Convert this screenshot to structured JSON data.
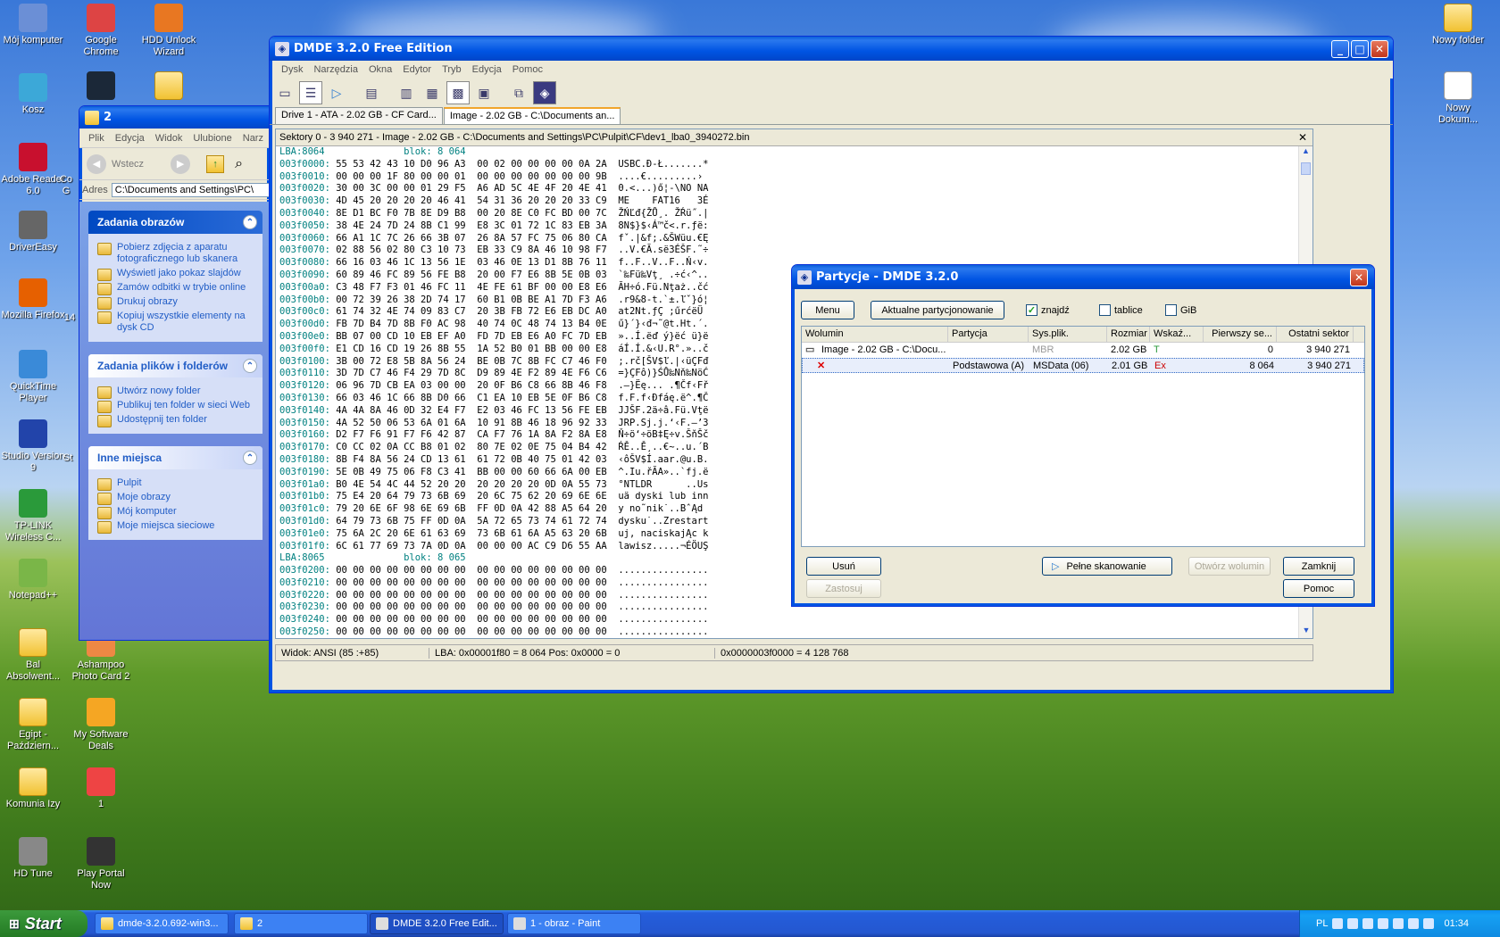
{
  "desktop_icons_left": [
    {
      "label": "Mój komputer",
      "icon": "computer-icon"
    },
    {
      "label": "Google Chrome",
      "icon": "chrome-icon"
    },
    {
      "label": "HDD Unlock Wizard",
      "icon": "hdd-unlock-icon"
    },
    {
      "label": "Kosz",
      "icon": "recycle-bin-icon"
    },
    {
      "label": "",
      "icon": "steam-icon"
    },
    {
      "label": "",
      "icon": "folder-icon"
    },
    {
      "label": "Adobe Reader 6.0",
      "icon": "adobe-reader-icon"
    },
    {
      "label": "DriverEasy",
      "icon": "drivereasy-icon"
    },
    {
      "label": "Mozilla Firefox",
      "icon": "firefox-icon"
    },
    {
      "label": "QuickTime Player",
      "icon": "quicktime-icon"
    },
    {
      "label": "Studio Version 9",
      "icon": "studio-icon"
    },
    {
      "label": "TP-LINK Wireless C...",
      "icon": "tplink-icon"
    },
    {
      "label": "Notepad++",
      "icon": "notepadpp-icon"
    },
    {
      "label": "Bal Absolwent...",
      "icon": "folder-icon"
    },
    {
      "label": "Ashampoo Photo Card 2",
      "icon": "ashampoo-icon"
    },
    {
      "label": "Egipt - Październ...",
      "icon": "folder-icon"
    },
    {
      "label": "My Software Deals",
      "icon": "cart-icon"
    },
    {
      "label": "Komunia Izy",
      "icon": "folder-icon"
    },
    {
      "label": "1",
      "icon": "image-file-icon"
    },
    {
      "label": "HD Tune",
      "icon": "hdtune-icon"
    },
    {
      "label": "Play Portal Now",
      "icon": "playportal-icon"
    }
  ],
  "desktop_icons_right": [
    {
      "label": "Nowy folder",
      "icon": "folder-icon"
    },
    {
      "label": "Nowy Dokum...",
      "icon": "text-doc-icon"
    }
  ],
  "partial_labels": {
    "a": "Co",
    "b": "G",
    "c": "14",
    "d": "St"
  },
  "explorer": {
    "title": "2",
    "menu": [
      "Plik",
      "Edycja",
      "Widok",
      "Ulubione",
      "Narz"
    ],
    "back_label": "Wstecz",
    "address_label": "Adres",
    "address_value": "C:\\Documents and Settings\\PC\\",
    "panels": [
      {
        "title": "Zadania obrazów",
        "items": [
          "Pobierz zdjęcia z aparatu fotograficznego lub skanera",
          "Wyświetl jako pokaz slajdów",
          "Zamów odbitki w trybie online",
          "Drukuj obrazy",
          "Kopiuj wszystkie elementy na dysk CD"
        ]
      },
      {
        "title": "Zadania plików i folderów",
        "items": [
          "Utwórz nowy folder",
          "Publikuj ten folder w sieci Web",
          "Udostępnij ten folder"
        ]
      },
      {
        "title": "Inne miejsca",
        "items": [
          "Pulpit",
          "Moje obrazy",
          "Mój komputer",
          "Moje miejsca sieciowe"
        ]
      }
    ]
  },
  "dmde": {
    "title": "DMDE 3.2.0 Free Edition",
    "menu": [
      "Dysk",
      "Narzędzia",
      "Okna",
      "Edytor",
      "Tryb",
      "Edycja",
      "Pomoc"
    ],
    "tabs": [
      "Drive 1 - ATA - 2.02 GB - CF Card...",
      "Image - 2.02 GB - C:\\Documents an..."
    ],
    "path": "Sektory 0 - 3 940 271 - Image - 2.02 GB - C:\\Documents and Settings\\PC\\Pulpit\\CF\\dev1_lba0_3940272.bin",
    "hex_lines": [
      [
        "LBA:8064",
        "blok: 8 064",
        "",
        ""
      ],
      [
        "003f0000:",
        "55 53 42 43 10 D0 96 A3  00 02 00 00 00 00 0A 2A",
        "USBC.Đ-Ł.......*"
      ],
      [
        "003f0010:",
        "00 00 00 1F 80 00 00 01  00 00 00 00 00 00 00 9B",
        "....€.........›"
      ],
      [
        "003f0020:",
        "30 00 3C 00 00 01 29 F5  A6 AD 5C 4E 4F 20 4E 41",
        "0.<...)ő¦-\\NO NA"
      ],
      [
        "003f0030:",
        "4D 45 20 20 20 20 46 41  54 31 36 20 20 20 33 C9",
        "ME    FAT16   3É"
      ],
      [
        "003f0040:",
        "8E D1 BC F0 7B 8E D9 B8  00 20 8E C0 FC BD 00 7C",
        "ŽŃĽđ{ŽŮ¸. ŽŔü˝.|"
      ],
      [
        "003f0050:",
        "38 4E 24 7D 24 8B C1 99  E8 3C 01 72 1C 83 EB 3A",
        "8N$}$‹Á™č<.r.ƒë:"
      ],
      [
        "003f0060:",
        "66 A1 1C 7C 26 66 3B 07  26 8A 57 FC 75 06 80 CA",
        "fˇ.|&f;.&ŠWüu.€Ę"
      ],
      [
        "003f0070:",
        "02 88 56 02 80 C3 10 73  EB 33 C9 8A 46 10 98 F7",
        "..V.€Ă.së3ÉŠF.˜÷"
      ],
      [
        "003f0080:",
        "66 16 03 46 1C 13 56 1E  03 46 0E 13 D1 8B 76 11",
        "f..F..V..F..Ń‹v."
      ],
      [
        "003f0090:",
        "60 89 46 FC 89 56 FE B8  20 00 F7 E6 8B 5E 0B 03",
        "`‰Fü‰Vţ¸ .÷ć‹^.."
      ],
      [
        "003f00a0:",
        "C3 48 F7 F3 01 46 FC 11  4E FE 61 BF 00 00 E8 E6",
        "ĂH÷ó.Fü.Nţaż..čć"
      ],
      [
        "003f00b0:",
        "00 72 39 26 38 2D 74 17  60 B1 0B BE A1 7D F3 A6",
        ".r9&8-t.`±.ľˇ}ó¦"
      ],
      [
        "003f00c0:",
        "61 74 32 4E 74 09 83 C7  20 3B FB 72 E6 EB DC A0",
        "at2Nt.ƒÇ ;űrćëÜ "
      ],
      [
        "003f00d0:",
        "FB 7D B4 7D 8B F0 AC 98  40 74 0C 48 74 13 B4 0E",
        "ű}´}‹đ¬˜@t.Ht.´."
      ],
      [
        "003f00e0:",
        "BB 07 00 CD 10 EB EF A0  FD 7D EB E6 A0 FC 7D EB",
        "»..Í.ëď ý}ëć ü}ë"
      ],
      [
        "003f00f0:",
        "E1 CD 16 CD 19 26 8B 55  1A 52 B0 01 BB 00 00 E8",
        "áÍ.Í.&‹U.R°.»..č"
      ],
      [
        "003f0100:",
        "3B 00 72 E8 5B 8A 56 24  BE 0B 7C 8B FC C7 46 F0",
        ";.rč[ŠV$ľ.|‹üÇFđ"
      ],
      [
        "003f0110:",
        "3D 7D C7 46 F4 29 7D 8C  D9 89 4E F2 89 4E F6 C6",
        "=}ÇFô)}ŚŮ‰Nň‰NöĆ"
      ],
      [
        "003f0120:",
        "06 96 7D CB EA 03 00 00  20 0F B6 C8 66 8B 46 F8",
        ".–}Ëę... .¶Čf‹Fř"
      ],
      [
        "003f0130:",
        "66 03 46 1C 66 8B D0 66  C1 EA 10 EB 5E 0F B6 C8",
        "f.F.f‹Đfáę.ë^.¶Č"
      ],
      [
        "003f0140:",
        "4A 4A 8A 46 0D 32 E4 F7  E2 03 46 FC 13 56 FE EB",
        "JJŠF.2ä÷â.Fü.Vţë"
      ],
      [
        "003f0150:",
        "4A 52 50 06 53 6A 01 6A  10 91 8B 46 18 96 92 33",
        "JRP.Sj.j.‘‹F.–’3"
      ],
      [
        "003f0160:",
        "D2 F7 F6 91 F7 F6 42 87  CA F7 76 1A 8A F2 8A E8",
        "Ň÷ö‘÷öB‡Ę÷v.ŠňŠč"
      ],
      [
        "003f0170:",
        "C0 CC 02 0A CC B8 01 02  80 7E 02 0E 75 04 B4 42",
        "ŔĚ..Ě¸..€~..u.´B"
      ],
      [
        "003f0180:",
        "8B F4 8A 56 24 CD 13 61  61 72 0B 40 75 01 42 03",
        "‹ôŠV$Í.aar.@u.B."
      ],
      [
        "003f0190:",
        "5E 0B 49 75 06 F8 C3 41  BB 00 00 60 66 6A 00 EB",
        "^.Iu.řĂA»..`fj.ë"
      ],
      [
        "003f01a0:",
        "B0 4E 54 4C 44 52 20 20  20 20 20 20 0D 0A 55 73",
        "°NTLDR      ..Us"
      ],
      [
        "003f01b0:",
        "75 E4 20 64 79 73 6B 69  20 6C 75 62 20 69 6E 6E",
        "uä dyski lub inn"
      ],
      [
        "003f01c0:",
        "79 20 6E 6F 98 6E 69 6B  FF 0D 0A 42 88 A5 64 20",
        "y no˜nik˙..BˆĄd "
      ],
      [
        "003f01d0:",
        "64 79 73 6B 75 FF 0D 0A  5A 72 65 73 74 61 72 74",
        "dysku˙..Zrestart"
      ],
      [
        "003f01e0:",
        "75 6A 2C 20 6E 61 63 69  73 6B 61 6A A5 63 20 6B",
        "uj, naciskajĄc k"
      ],
      [
        "003f01f0:",
        "6C 61 77 69 73 7A 0D 0A  00 00 00 AC C9 D6 55 AA",
        "lawisz.....¬ÉÖUŞ"
      ],
      [
        "LBA:8065",
        "blok: 8 065",
        "",
        ""
      ],
      [
        "003f0200:",
        "00 00 00 00 00 00 00 00  00 00 00 00 00 00 00 00",
        "................"
      ],
      [
        "003f0210:",
        "00 00 00 00 00 00 00 00  00 00 00 00 00 00 00 00",
        "................"
      ],
      [
        "003f0220:",
        "00 00 00 00 00 00 00 00  00 00 00 00 00 00 00 00",
        "................"
      ],
      [
        "003f0230:",
        "00 00 00 00 00 00 00 00  00 00 00 00 00 00 00 00",
        "................"
      ],
      [
        "003f0240:",
        "00 00 00 00 00 00 00 00  00 00 00 00 00 00 00 00",
        "................"
      ],
      [
        "003f0250:",
        "00 00 00 00 00 00 00 00  00 00 00 00 00 00 00 00",
        "................"
      ]
    ],
    "status": [
      "Widok:  ANSI (85 :+85)",
      "LBA: 0x00001f80 = 8 064  Pos: 0x0000 = 0",
      "0x0000003f0000 = 4 128 768"
    ]
  },
  "partitions": {
    "title": "Partycje - DMDE 3.2.0",
    "menu_button": "Menu",
    "current_button": "Aktualne partycjonowanie",
    "checkboxes": [
      {
        "label": "znajdź",
        "checked": true
      },
      {
        "label": "tablice",
        "checked": false
      },
      {
        "label": "GiB",
        "checked": false
      }
    ],
    "columns": [
      "Wolumin",
      "Partycja",
      "Sys.plik.",
      "Rozmiar",
      "Wskaź...",
      "Pierwszy se...",
      "Ostatni sektor"
    ],
    "rows": [
      [
        "Image - 2.02 GB - C:\\Docu...",
        "",
        "MBR",
        "2.02 GB",
        "T",
        "0",
        "3 940 271"
      ],
      [
        "",
        "Podstawowa (A)",
        "MSData (06)",
        "2.01 GB",
        "Ex",
        "8 064",
        "3 940 271"
      ]
    ],
    "buttons": {
      "remove": "Usuń",
      "full_scan": "Pełne skanowanie",
      "open_volume": "Otwórz wolumin",
      "close": "Zamknij",
      "apply": "Zastosuj",
      "help": "Pomoc"
    }
  },
  "taskbar": {
    "start": "Start",
    "items": [
      "dmde-3.2.0.692-win3...",
      "2",
      "DMDE 3.2.0 Free Edit...",
      "1 - obraz - Paint"
    ],
    "lang": "PL",
    "clock": "01:34"
  },
  "colors": {
    "xp_blue": "#0054e3",
    "selection": "#316ac5",
    "hex_address": "#008080"
  }
}
